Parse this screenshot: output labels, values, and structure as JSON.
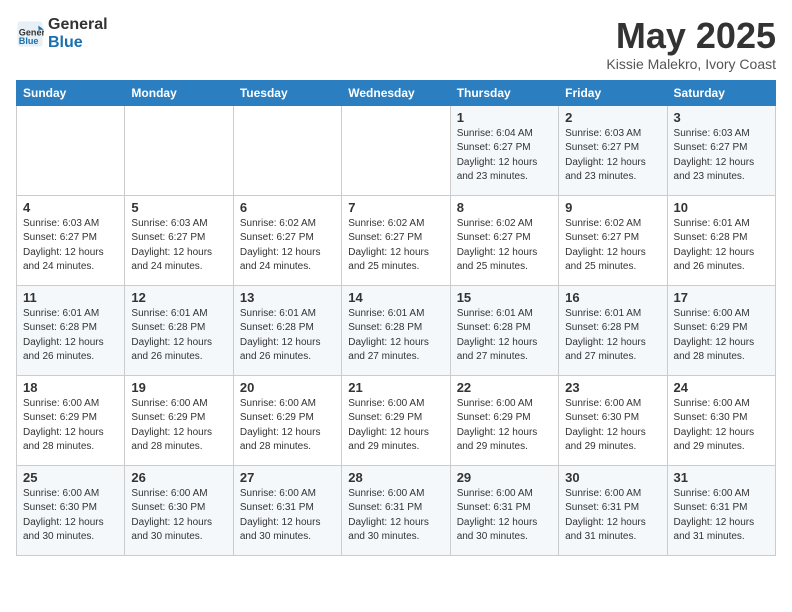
{
  "header": {
    "logo_line1": "General",
    "logo_line2": "Blue",
    "month_title": "May 2025",
    "location": "Kissie Malekro, Ivory Coast"
  },
  "days_of_week": [
    "Sunday",
    "Monday",
    "Tuesday",
    "Wednesday",
    "Thursday",
    "Friday",
    "Saturday"
  ],
  "weeks": [
    [
      {
        "day": "",
        "info": ""
      },
      {
        "day": "",
        "info": ""
      },
      {
        "day": "",
        "info": ""
      },
      {
        "day": "",
        "info": ""
      },
      {
        "day": "1",
        "info": "Sunrise: 6:04 AM\nSunset: 6:27 PM\nDaylight: 12 hours\nand 23 minutes."
      },
      {
        "day": "2",
        "info": "Sunrise: 6:03 AM\nSunset: 6:27 PM\nDaylight: 12 hours\nand 23 minutes."
      },
      {
        "day": "3",
        "info": "Sunrise: 6:03 AM\nSunset: 6:27 PM\nDaylight: 12 hours\nand 23 minutes."
      }
    ],
    [
      {
        "day": "4",
        "info": "Sunrise: 6:03 AM\nSunset: 6:27 PM\nDaylight: 12 hours\nand 24 minutes."
      },
      {
        "day": "5",
        "info": "Sunrise: 6:03 AM\nSunset: 6:27 PM\nDaylight: 12 hours\nand 24 minutes."
      },
      {
        "day": "6",
        "info": "Sunrise: 6:02 AM\nSunset: 6:27 PM\nDaylight: 12 hours\nand 24 minutes."
      },
      {
        "day": "7",
        "info": "Sunrise: 6:02 AM\nSunset: 6:27 PM\nDaylight: 12 hours\nand 25 minutes."
      },
      {
        "day": "8",
        "info": "Sunrise: 6:02 AM\nSunset: 6:27 PM\nDaylight: 12 hours\nand 25 minutes."
      },
      {
        "day": "9",
        "info": "Sunrise: 6:02 AM\nSunset: 6:27 PM\nDaylight: 12 hours\nand 25 minutes."
      },
      {
        "day": "10",
        "info": "Sunrise: 6:01 AM\nSunset: 6:28 PM\nDaylight: 12 hours\nand 26 minutes."
      }
    ],
    [
      {
        "day": "11",
        "info": "Sunrise: 6:01 AM\nSunset: 6:28 PM\nDaylight: 12 hours\nand 26 minutes."
      },
      {
        "day": "12",
        "info": "Sunrise: 6:01 AM\nSunset: 6:28 PM\nDaylight: 12 hours\nand 26 minutes."
      },
      {
        "day": "13",
        "info": "Sunrise: 6:01 AM\nSunset: 6:28 PM\nDaylight: 12 hours\nand 26 minutes."
      },
      {
        "day": "14",
        "info": "Sunrise: 6:01 AM\nSunset: 6:28 PM\nDaylight: 12 hours\nand 27 minutes."
      },
      {
        "day": "15",
        "info": "Sunrise: 6:01 AM\nSunset: 6:28 PM\nDaylight: 12 hours\nand 27 minutes."
      },
      {
        "day": "16",
        "info": "Sunrise: 6:01 AM\nSunset: 6:28 PM\nDaylight: 12 hours\nand 27 minutes."
      },
      {
        "day": "17",
        "info": "Sunrise: 6:00 AM\nSunset: 6:29 PM\nDaylight: 12 hours\nand 28 minutes."
      }
    ],
    [
      {
        "day": "18",
        "info": "Sunrise: 6:00 AM\nSunset: 6:29 PM\nDaylight: 12 hours\nand 28 minutes."
      },
      {
        "day": "19",
        "info": "Sunrise: 6:00 AM\nSunset: 6:29 PM\nDaylight: 12 hours\nand 28 minutes."
      },
      {
        "day": "20",
        "info": "Sunrise: 6:00 AM\nSunset: 6:29 PM\nDaylight: 12 hours\nand 28 minutes."
      },
      {
        "day": "21",
        "info": "Sunrise: 6:00 AM\nSunset: 6:29 PM\nDaylight: 12 hours\nand 29 minutes."
      },
      {
        "day": "22",
        "info": "Sunrise: 6:00 AM\nSunset: 6:29 PM\nDaylight: 12 hours\nand 29 minutes."
      },
      {
        "day": "23",
        "info": "Sunrise: 6:00 AM\nSunset: 6:30 PM\nDaylight: 12 hours\nand 29 minutes."
      },
      {
        "day": "24",
        "info": "Sunrise: 6:00 AM\nSunset: 6:30 PM\nDaylight: 12 hours\nand 29 minutes."
      }
    ],
    [
      {
        "day": "25",
        "info": "Sunrise: 6:00 AM\nSunset: 6:30 PM\nDaylight: 12 hours\nand 30 minutes."
      },
      {
        "day": "26",
        "info": "Sunrise: 6:00 AM\nSunset: 6:30 PM\nDaylight: 12 hours\nand 30 minutes."
      },
      {
        "day": "27",
        "info": "Sunrise: 6:00 AM\nSunset: 6:31 PM\nDaylight: 12 hours\nand 30 minutes."
      },
      {
        "day": "28",
        "info": "Sunrise: 6:00 AM\nSunset: 6:31 PM\nDaylight: 12 hours\nand 30 minutes."
      },
      {
        "day": "29",
        "info": "Sunrise: 6:00 AM\nSunset: 6:31 PM\nDaylight: 12 hours\nand 30 minutes."
      },
      {
        "day": "30",
        "info": "Sunrise: 6:00 AM\nSunset: 6:31 PM\nDaylight: 12 hours\nand 31 minutes."
      },
      {
        "day": "31",
        "info": "Sunrise: 6:00 AM\nSunset: 6:31 PM\nDaylight: 12 hours\nand 31 minutes."
      }
    ]
  ]
}
